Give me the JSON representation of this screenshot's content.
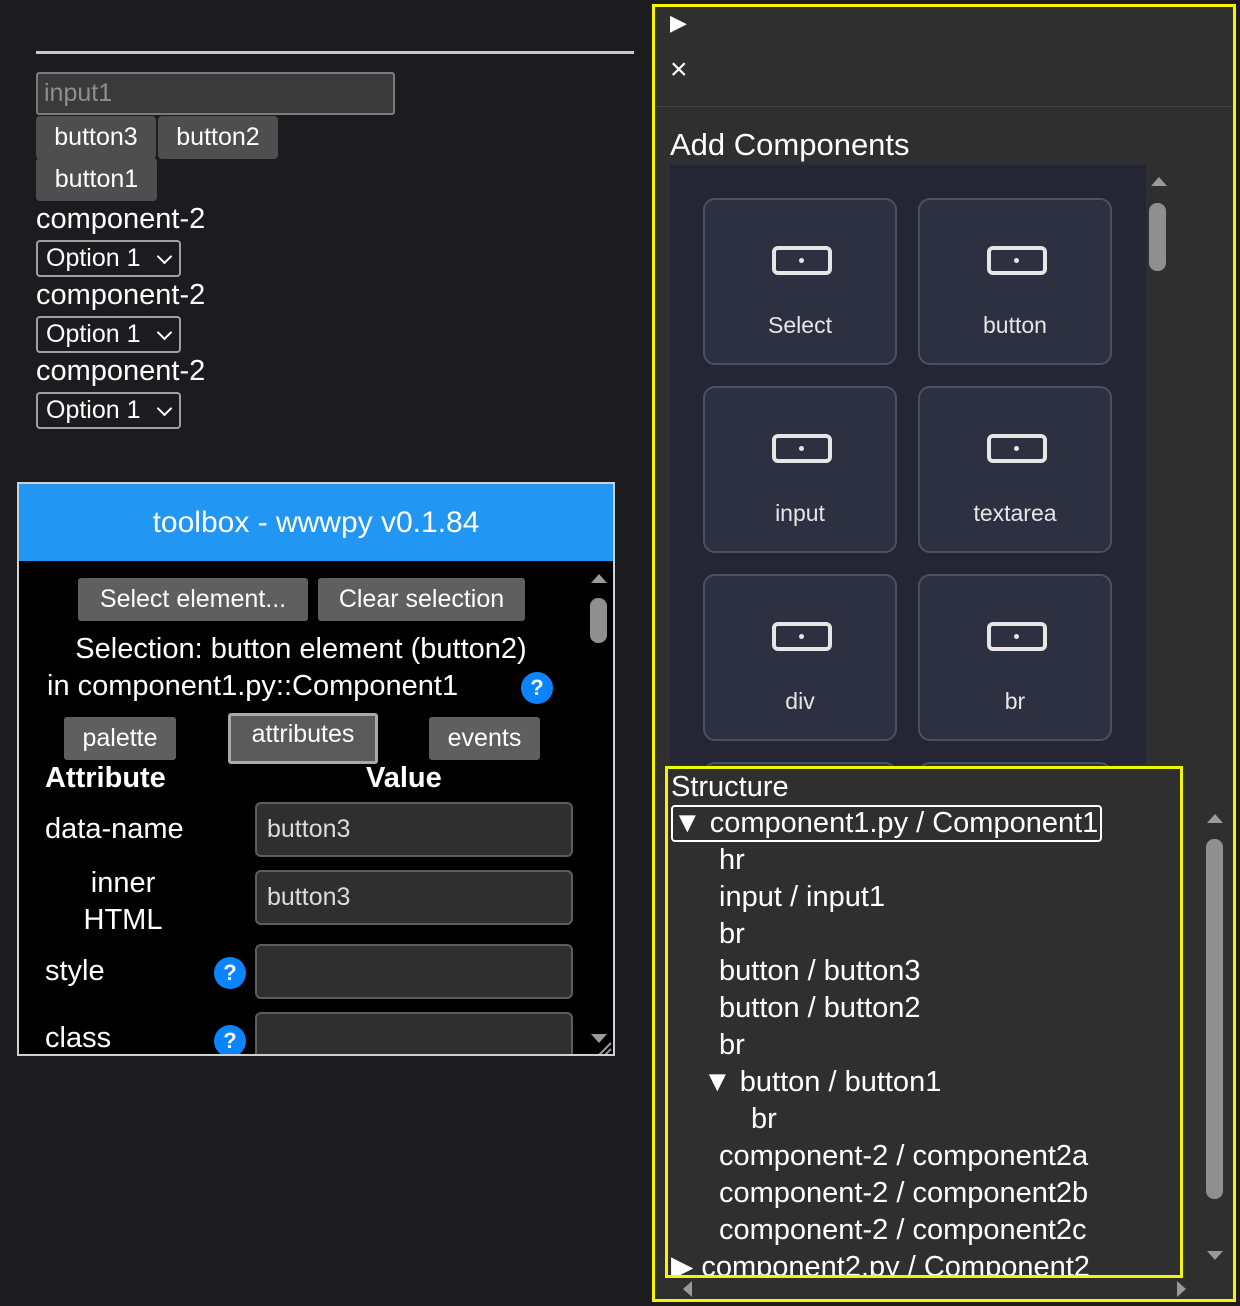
{
  "preview": {
    "input_placeholder": "input1",
    "buttons": [
      "button3",
      "button2",
      "button1"
    ],
    "components": [
      {
        "label": "component-2",
        "select_value": "Option 1"
      },
      {
        "label": "component-2",
        "select_value": "Option 1"
      },
      {
        "label": "component-2",
        "select_value": "Option 1"
      }
    ]
  },
  "toolbox": {
    "title": "toolbox - wwwpy v0.1.84",
    "select_element_label": "Select element...",
    "clear_selection_label": "Clear selection",
    "selection_line1": "Selection: button element (button2)",
    "selection_line2": "in component1.py::Component1",
    "help_glyph": "?",
    "tabs": {
      "palette": "palette",
      "attributes": "attributes",
      "events": "events"
    },
    "header_attribute": "Attribute",
    "header_value": "Value",
    "rows": [
      {
        "name": "data-name",
        "value": "button3"
      },
      {
        "name_line1": "inner",
        "name_line2": "HTML",
        "value": "button3"
      },
      {
        "name": "style",
        "value": ""
      },
      {
        "name": "class",
        "value": ""
      }
    ],
    "accent_color": "#2196f3"
  },
  "right_panel": {
    "play_glyph": "▶",
    "close_glyph": "×",
    "add_components_title": "Add Components",
    "components": [
      "Select",
      "button",
      "input",
      "textarea",
      "div",
      "br"
    ],
    "structure_title": "Structure",
    "tree": [
      {
        "label": "component1.py / Component1",
        "arrow": "▼"
      },
      {
        "label": "hr"
      },
      {
        "label": "input / input1"
      },
      {
        "label": "br"
      },
      {
        "label": "button / button3"
      },
      {
        "label": "button / button2"
      },
      {
        "label": "br"
      },
      {
        "label": "button / button1",
        "arrow": "▼"
      },
      {
        "label": "br"
      },
      {
        "label": "component-2 / component2a"
      },
      {
        "label": "component-2 / component2b"
      },
      {
        "label": "component-2 / component2c"
      },
      {
        "label": "component2.py / Component2",
        "arrow": "▶"
      }
    ],
    "highlight_color": "#f5f500"
  }
}
